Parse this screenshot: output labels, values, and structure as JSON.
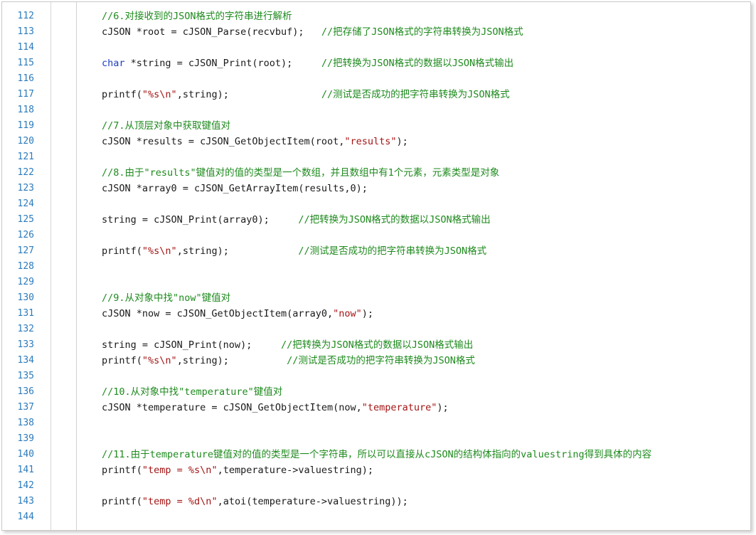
{
  "colors": {
    "line_number": "#2b7bbd",
    "comment": "#1e8a1e",
    "keyword": "#1f3fbf",
    "string": "#a31515",
    "plain": "#1a1a1a"
  },
  "code_lines": [
    {
      "n": "112",
      "tokens": [
        {
          "t": "comment",
          "v": "//6.对接收到的JSON格式的字符串进行解析"
        }
      ]
    },
    {
      "n": "113",
      "tokens": [
        {
          "t": "plain",
          "v": "cJSON *root = cJSON_Parse(recvbuf);   "
        },
        {
          "t": "comment",
          "v": "//把存储了JSON格式的字符串转换为JSON格式"
        }
      ]
    },
    {
      "n": "114",
      "tokens": []
    },
    {
      "n": "115",
      "tokens": [
        {
          "t": "keyword",
          "v": "char"
        },
        {
          "t": "plain",
          "v": " *string = cJSON_Print(root);     "
        },
        {
          "t": "comment",
          "v": "//把转换为JSON格式的数据以JSON格式输出"
        }
      ]
    },
    {
      "n": "116",
      "tokens": []
    },
    {
      "n": "117",
      "tokens": [
        {
          "t": "plain",
          "v": "printf("
        },
        {
          "t": "string",
          "v": "\"%s\\n\""
        },
        {
          "t": "plain",
          "v": ",string);                "
        },
        {
          "t": "comment",
          "v": "//测试是否成功的把字符串转换为JSON格式"
        }
      ]
    },
    {
      "n": "118",
      "tokens": []
    },
    {
      "n": "119",
      "tokens": [
        {
          "t": "comment",
          "v": "//7.从顶层对象中获取键值对"
        }
      ]
    },
    {
      "n": "120",
      "tokens": [
        {
          "t": "plain",
          "v": "cJSON *results = cJSON_GetObjectItem(root,"
        },
        {
          "t": "string",
          "v": "\"results\""
        },
        {
          "t": "plain",
          "v": ");"
        }
      ]
    },
    {
      "n": "121",
      "tokens": []
    },
    {
      "n": "122",
      "tokens": [
        {
          "t": "comment",
          "v": "//8.由于\"results\"键值对的值的类型是一个数组，并且数组中有1个元素，元素类型是对象"
        }
      ]
    },
    {
      "n": "123",
      "tokens": [
        {
          "t": "plain",
          "v": "cJSON *array0 = cJSON_GetArrayItem(results,"
        },
        {
          "t": "number",
          "v": "0"
        },
        {
          "t": "plain",
          "v": ");"
        }
      ]
    },
    {
      "n": "124",
      "tokens": []
    },
    {
      "n": "125",
      "tokens": [
        {
          "t": "plain",
          "v": "string = cJSON_Print(array0);     "
        },
        {
          "t": "comment",
          "v": "//把转换为JSON格式的数据以JSON格式输出"
        }
      ]
    },
    {
      "n": "126",
      "tokens": []
    },
    {
      "n": "127",
      "tokens": [
        {
          "t": "plain",
          "v": "printf("
        },
        {
          "t": "string",
          "v": "\"%s\\n\""
        },
        {
          "t": "plain",
          "v": ",string);            "
        },
        {
          "t": "comment",
          "v": "//测试是否成功的把字符串转换为JSON格式"
        }
      ]
    },
    {
      "n": "128",
      "tokens": []
    },
    {
      "n": "129",
      "tokens": []
    },
    {
      "n": "130",
      "tokens": [
        {
          "t": "comment",
          "v": "//9.从对象中找\"now\"键值对"
        }
      ]
    },
    {
      "n": "131",
      "tokens": [
        {
          "t": "plain",
          "v": "cJSON *now = cJSON_GetObjectItem(array0,"
        },
        {
          "t": "string",
          "v": "\"now\""
        },
        {
          "t": "plain",
          "v": ");"
        }
      ]
    },
    {
      "n": "132",
      "tokens": []
    },
    {
      "n": "133",
      "tokens": [
        {
          "t": "plain",
          "v": "string = cJSON_Print(now);     "
        },
        {
          "t": "comment",
          "v": "//把转换为JSON格式的数据以JSON格式输出"
        }
      ]
    },
    {
      "n": "134",
      "tokens": [
        {
          "t": "plain",
          "v": "printf("
        },
        {
          "t": "string",
          "v": "\"%s\\n\""
        },
        {
          "t": "plain",
          "v": ",string);          "
        },
        {
          "t": "comment",
          "v": "//测试是否成功的把字符串转换为JSON格式"
        }
      ]
    },
    {
      "n": "135",
      "tokens": []
    },
    {
      "n": "136",
      "tokens": [
        {
          "t": "comment",
          "v": "//10.从对象中找\"temperature\"键值对"
        }
      ]
    },
    {
      "n": "137",
      "tokens": [
        {
          "t": "plain",
          "v": "cJSON *temperature = cJSON_GetObjectItem(now,"
        },
        {
          "t": "string",
          "v": "\"temperature\""
        },
        {
          "t": "plain",
          "v": ");"
        }
      ]
    },
    {
      "n": "138",
      "tokens": []
    },
    {
      "n": "139",
      "tokens": []
    },
    {
      "n": "140",
      "tokens": [
        {
          "t": "comment",
          "v": "//11.由于temperature键值对的值的类型是一个字符串，所以可以直接从cJSON的结构体指向的valuestring得到具体的内容"
        }
      ]
    },
    {
      "n": "141",
      "tokens": [
        {
          "t": "plain",
          "v": "printf("
        },
        {
          "t": "string",
          "v": "\"temp = %s\\n\""
        },
        {
          "t": "plain",
          "v": ",temperature->valuestring);"
        }
      ]
    },
    {
      "n": "142",
      "tokens": []
    },
    {
      "n": "143",
      "tokens": [
        {
          "t": "plain",
          "v": "printf("
        },
        {
          "t": "string",
          "v": "\"temp = %d\\n\""
        },
        {
          "t": "plain",
          "v": ",atoi(temperature->valuestring));"
        }
      ]
    },
    {
      "n": "144",
      "tokens": []
    }
  ]
}
